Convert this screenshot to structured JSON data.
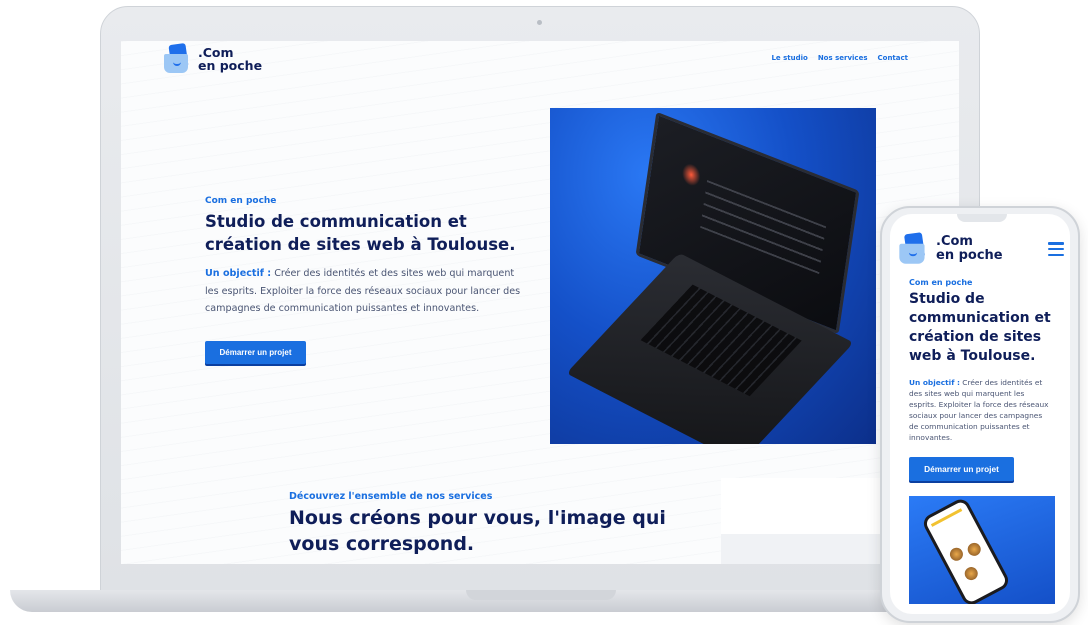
{
  "brand": {
    "name_line1": ".Com",
    "name_line2": "en poche"
  },
  "nav": {
    "items": [
      {
        "label": "Le studio"
      },
      {
        "label": "Nos services"
      },
      {
        "label": "Contact"
      }
    ]
  },
  "hero": {
    "eyebrow": "Com en poche",
    "title": "Studio de communication et création de sites web à Toulouse.",
    "body_lead": "Un objectif :",
    "body_text": " Créer des identités et des sites web qui marquent les esprits. Exploiter la force des réseaux sociaux pour lancer des campagnes de communication puissantes et innovantes.",
    "cta_label": "Démarrer un projet"
  },
  "services": {
    "eyebrow": "Découvrez l'ensemble de nos services",
    "title": "Nous créons pour vous, l'image qui vous correspond."
  },
  "colors": {
    "accent": "#1a6fe0",
    "heading": "#0f1e59",
    "body": "#4a5573"
  },
  "icons": {
    "menu": "hamburger-menu-icon",
    "logo": "pocket-card-logo-icon"
  }
}
